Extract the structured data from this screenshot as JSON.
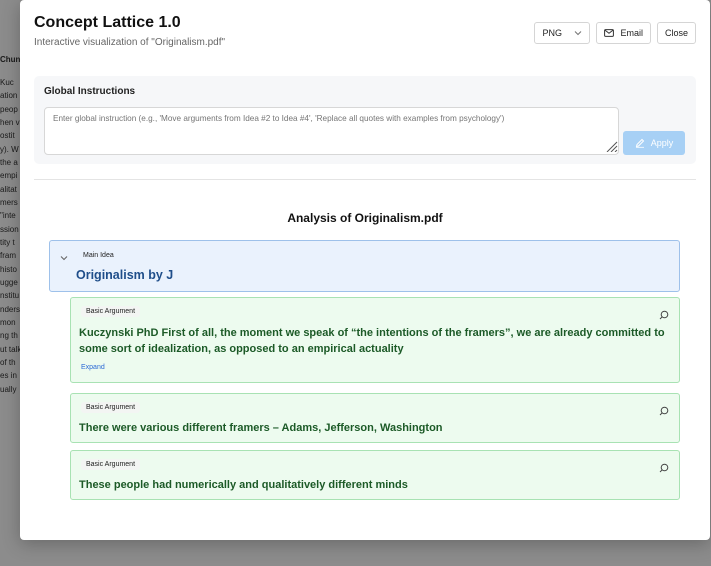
{
  "background": {
    "left_tab_label": "Chun",
    "lines": [
      "Kuc",
      "ation",
      "peop",
      "hen v",
      "ostit",
      "y). W",
      "the a",
      "empi",
      "alitat",
      "mers",
      "\"inte",
      "ssion",
      "tity t",
      "fram",
      "histo",
      "ugge",
      "nstitu",
      "nders",
      "mon",
      "ng th",
      "ut talk",
      "of th",
      "es in",
      "ually"
    ]
  },
  "modal": {
    "title": "Concept Lattice 1.0",
    "subtitle": "Interactive visualization of \"Originalism.pdf\"",
    "format_select": {
      "value": "PNG"
    },
    "email_label": "Email",
    "close_label": "Close"
  },
  "global_instructions": {
    "title": "Global Instructions",
    "placeholder": "Enter global instruction (e.g., 'Move arguments from Idea #2 to Idea #4', 'Replace all quotes with examples from psychology')",
    "apply_label": "Apply"
  },
  "analysis": {
    "title": "Analysis of Originalism.pdf",
    "main_idea": {
      "tag": "Main Idea",
      "text": "Originalism by J"
    },
    "arguments": [
      {
        "tag": "Basic Argument",
        "text": "Kuczynski PhD First of all, the moment we speak of “the intentions of the framers”, we are already committed to some sort of idealization, as opposed to an empirical actuality",
        "expand_label": "Expand"
      },
      {
        "tag": "Basic Argument",
        "text": "There were various different framers – Adams, Jefferson, Washington"
      },
      {
        "tag": "Basic Argument",
        "text": "These people had numerically and qualitatively different minds"
      }
    ]
  },
  "colors": {
    "main_idea_bg": "#eaf2fd",
    "main_idea_text": "#1f4e8a",
    "argument_bg": "#edfbef",
    "argument_text": "#1c5a27",
    "apply_button": "#a7d0f5"
  }
}
